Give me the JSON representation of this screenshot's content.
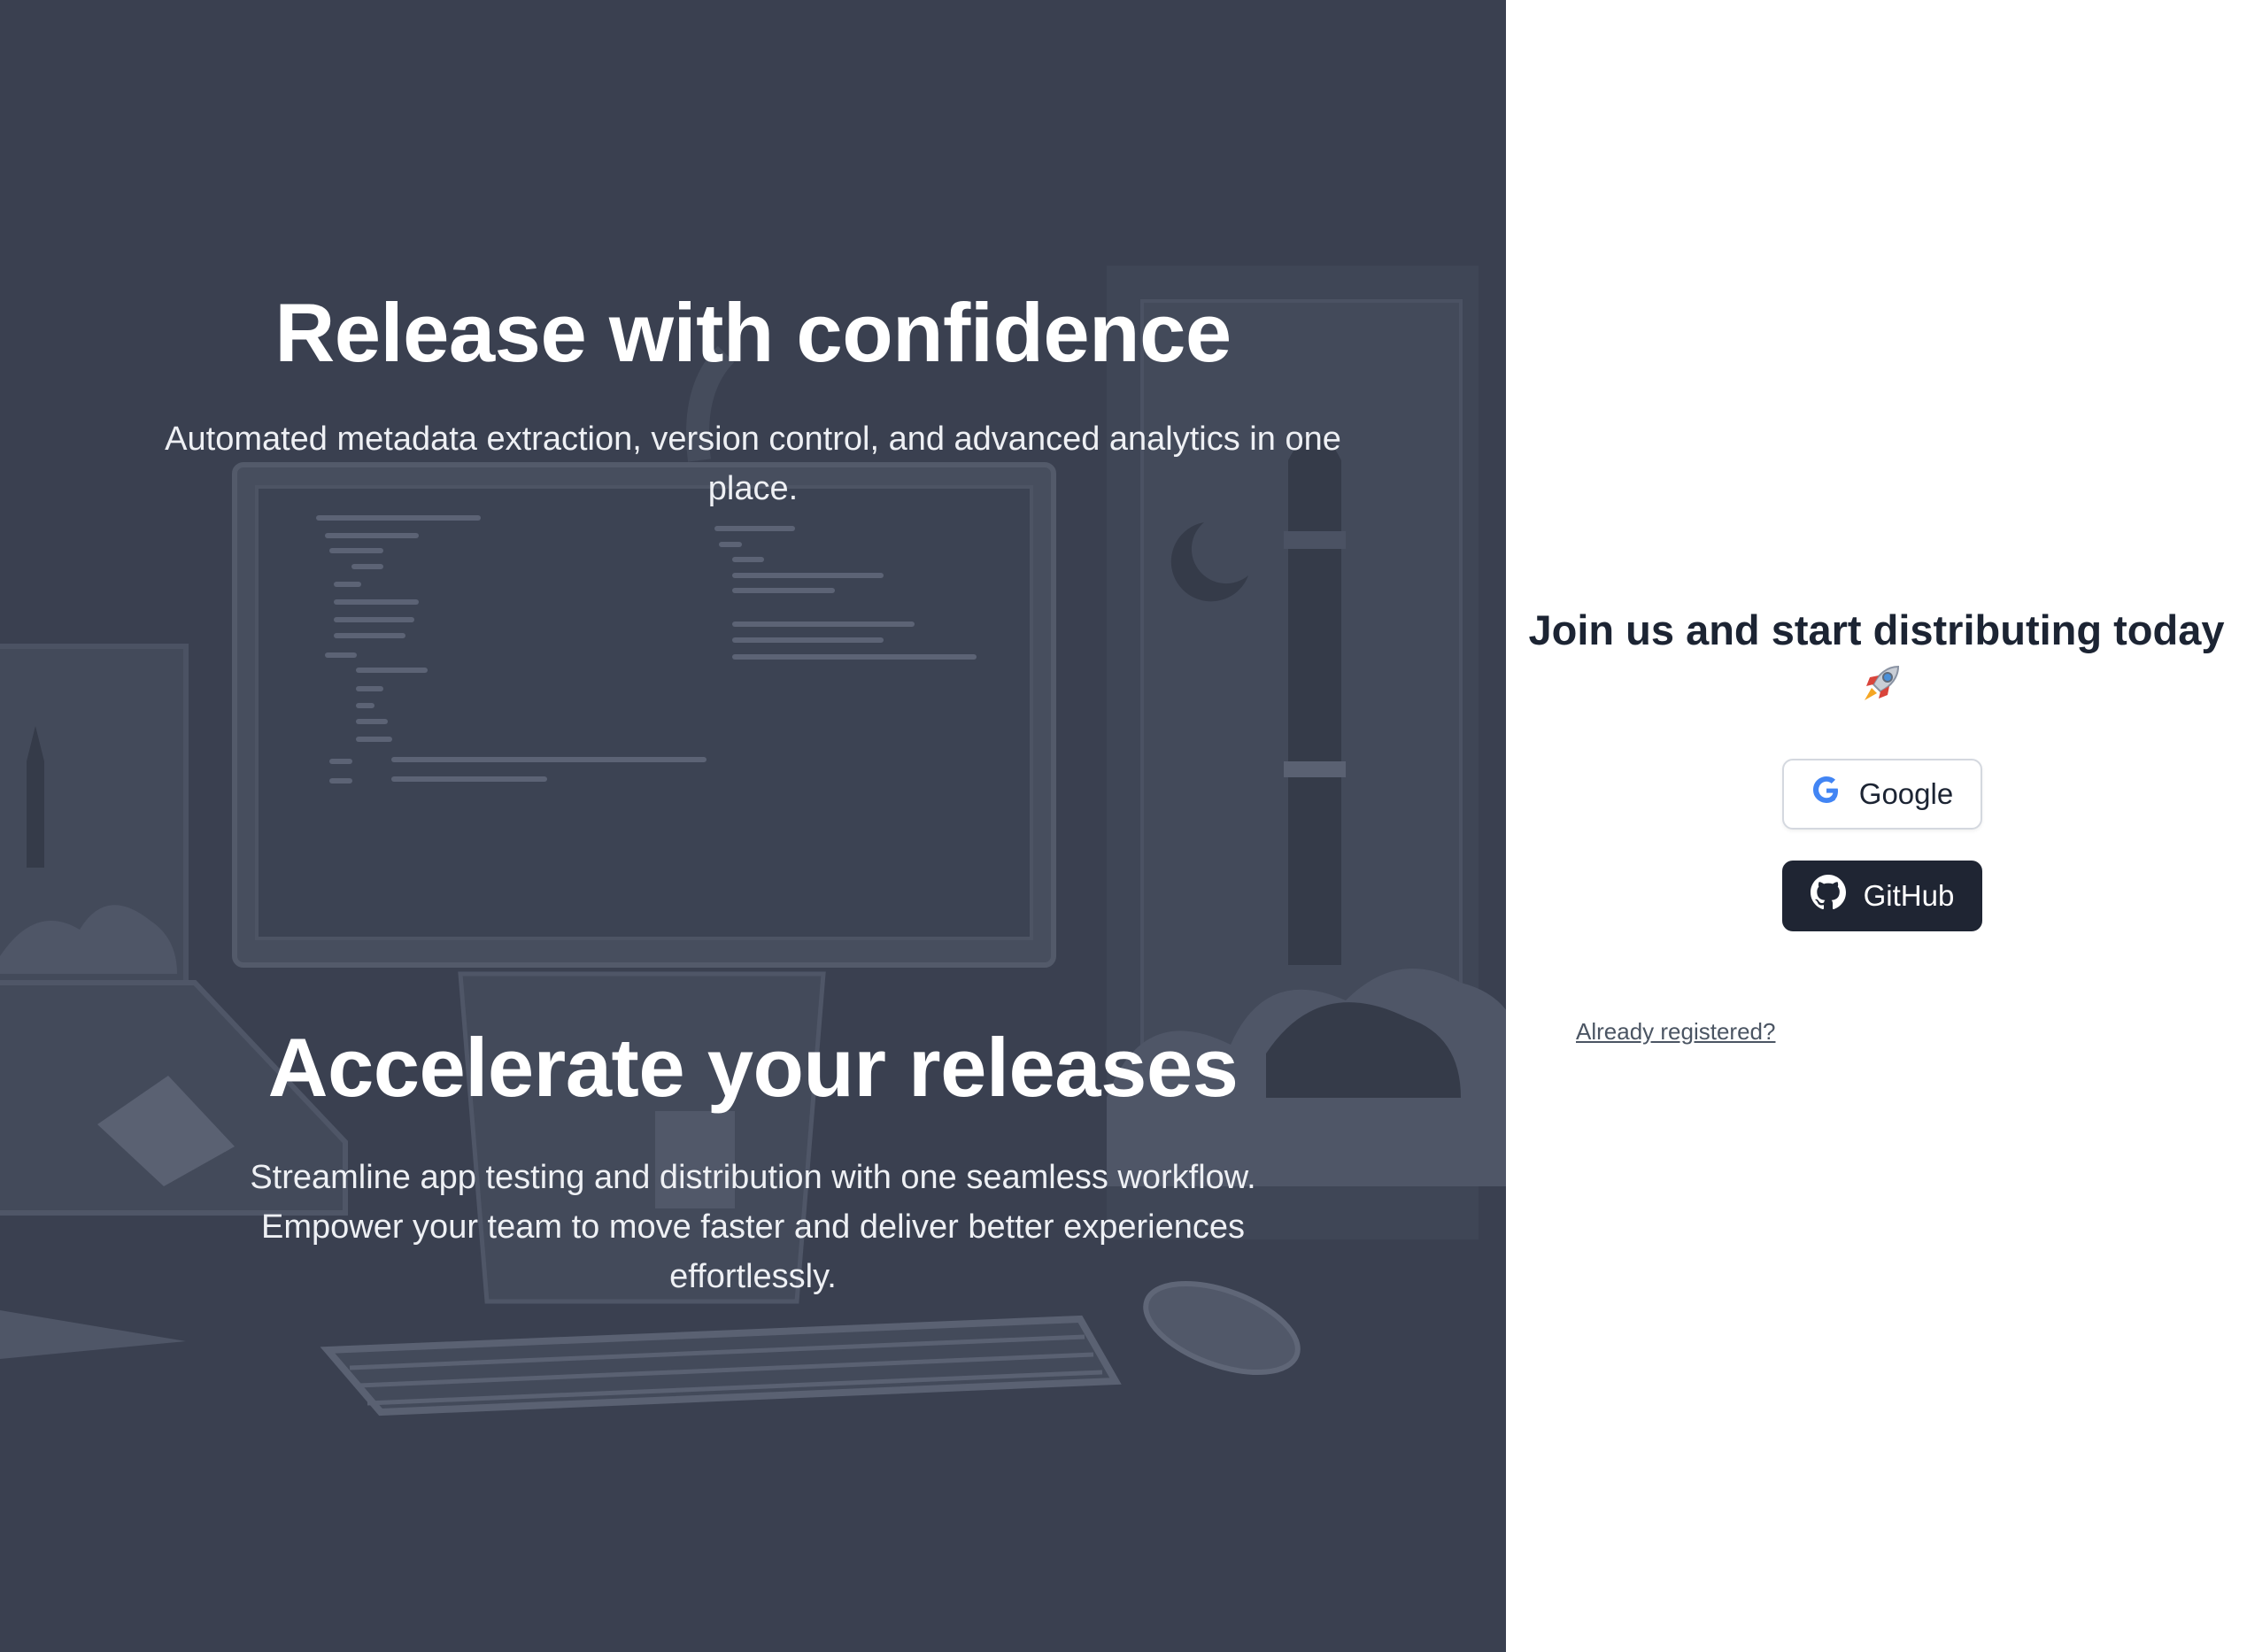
{
  "hero": {
    "sections": [
      {
        "title": "Release with confidence",
        "subtitle": "Automated metadata extraction, version control, and advanced analytics in one place."
      },
      {
        "title": "Accelerate your releases",
        "subtitle": "Streamline app testing and distribution with one seamless workflow. Empower your team to move faster and deliver better experiences effortlessly."
      }
    ],
    "background_color": "#3a4050"
  },
  "auth": {
    "title": "Join us and start distributing today",
    "title_icon": "rocket-icon",
    "google_label": "Google",
    "github_label": "GitHub",
    "already_registered": "Already registered?"
  },
  "colors": {
    "dark_text": "#1c2433",
    "github_button": "#1f2533",
    "google_blue": "#4285F4",
    "link": "#4b5563"
  }
}
